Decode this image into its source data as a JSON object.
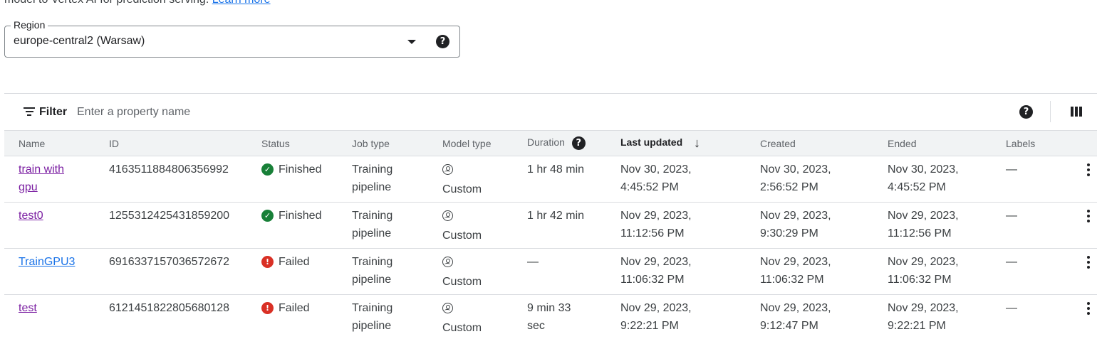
{
  "intro": {
    "text": "model to Vertex AI for prediction serving.",
    "link": "Learn more"
  },
  "region": {
    "label": "Region",
    "value": "europe-central2 (Warsaw)",
    "help_icon": "help-icon",
    "caret_icon": "arrow-drop-down-icon"
  },
  "filter": {
    "label": "Filter",
    "placeholder": "Enter a property name"
  },
  "table": {
    "columns": {
      "name": "Name",
      "id": "ID",
      "status": "Status",
      "job_type": "Job type",
      "model_type": "Model type",
      "duration": "Duration",
      "last_updated": "Last updated",
      "created": "Created",
      "ended": "Ended",
      "labels": "Labels"
    },
    "sort": {
      "column": "last_updated",
      "direction": "descending"
    },
    "rows": [
      {
        "name_line1": "train with",
        "name_line2": "gpu",
        "id": "4163511884806356992",
        "status": "Finished",
        "status_kind": "success",
        "job_type_line1": "Training",
        "job_type_line2": "pipeline",
        "model_type": "Custom",
        "duration_line1": "1 hr 48 min",
        "duration_line2": "",
        "updated_line1": "Nov 30, 2023,",
        "updated_line2": "4:45:52 PM",
        "created_line1": "Nov 30, 2023,",
        "created_line2": "2:56:52 PM",
        "ended_line1": "Nov 30, 2023,",
        "ended_line2": "4:45:52 PM",
        "labels": "—"
      },
      {
        "name_line1": "test0",
        "name_line2": "",
        "id": "1255312425431859200",
        "status": "Finished",
        "status_kind": "success",
        "job_type_line1": "Training",
        "job_type_line2": "pipeline",
        "model_type": "Custom",
        "duration_line1": "1 hr 42 min",
        "duration_line2": "",
        "updated_line1": "Nov 29, 2023,",
        "updated_line2": "11:12:56 PM",
        "created_line1": "Nov 29, 2023,",
        "created_line2": "9:30:29 PM",
        "ended_line1": "Nov 29, 2023,",
        "ended_line2": "11:12:56 PM",
        "labels": "—"
      },
      {
        "name_line1": "TrainGPU3",
        "name_line2": "",
        "id": "6916337157036572672",
        "status": "Failed",
        "status_kind": "error",
        "job_type_line1": "Training",
        "job_type_line2": "pipeline",
        "model_type": "Custom",
        "duration_line1": "—",
        "duration_line2": "",
        "updated_line1": "Nov 29, 2023,",
        "updated_line2": "11:06:32 PM",
        "created_line1": "Nov 29, 2023,",
        "created_line2": "11:06:32 PM",
        "ended_line1": "Nov 29, 2023,",
        "ended_line2": "11:06:32 PM",
        "labels": "—"
      },
      {
        "name_line1": "test",
        "name_line2": "",
        "id": "6121451822805680128",
        "status": "Failed",
        "status_kind": "error",
        "job_type_line1": "Training",
        "job_type_line2": "pipeline",
        "model_type": "Custom",
        "duration_line1": "9 min 33",
        "duration_line2": "sec",
        "updated_line1": "Nov 29, 2023,",
        "updated_line2": "9:22:21 PM",
        "created_line1": "Nov 29, 2023,",
        "created_line2": "9:12:47 PM",
        "ended_line1": "Nov 29, 2023,",
        "ended_line2": "9:22:21 PM",
        "labels": "—"
      }
    ]
  },
  "colors": {
    "link": "#1a73e8",
    "visited_link": "#7b1fa2",
    "success": "#188038",
    "error": "#d93025",
    "header_bg": "#f1f3f4"
  }
}
